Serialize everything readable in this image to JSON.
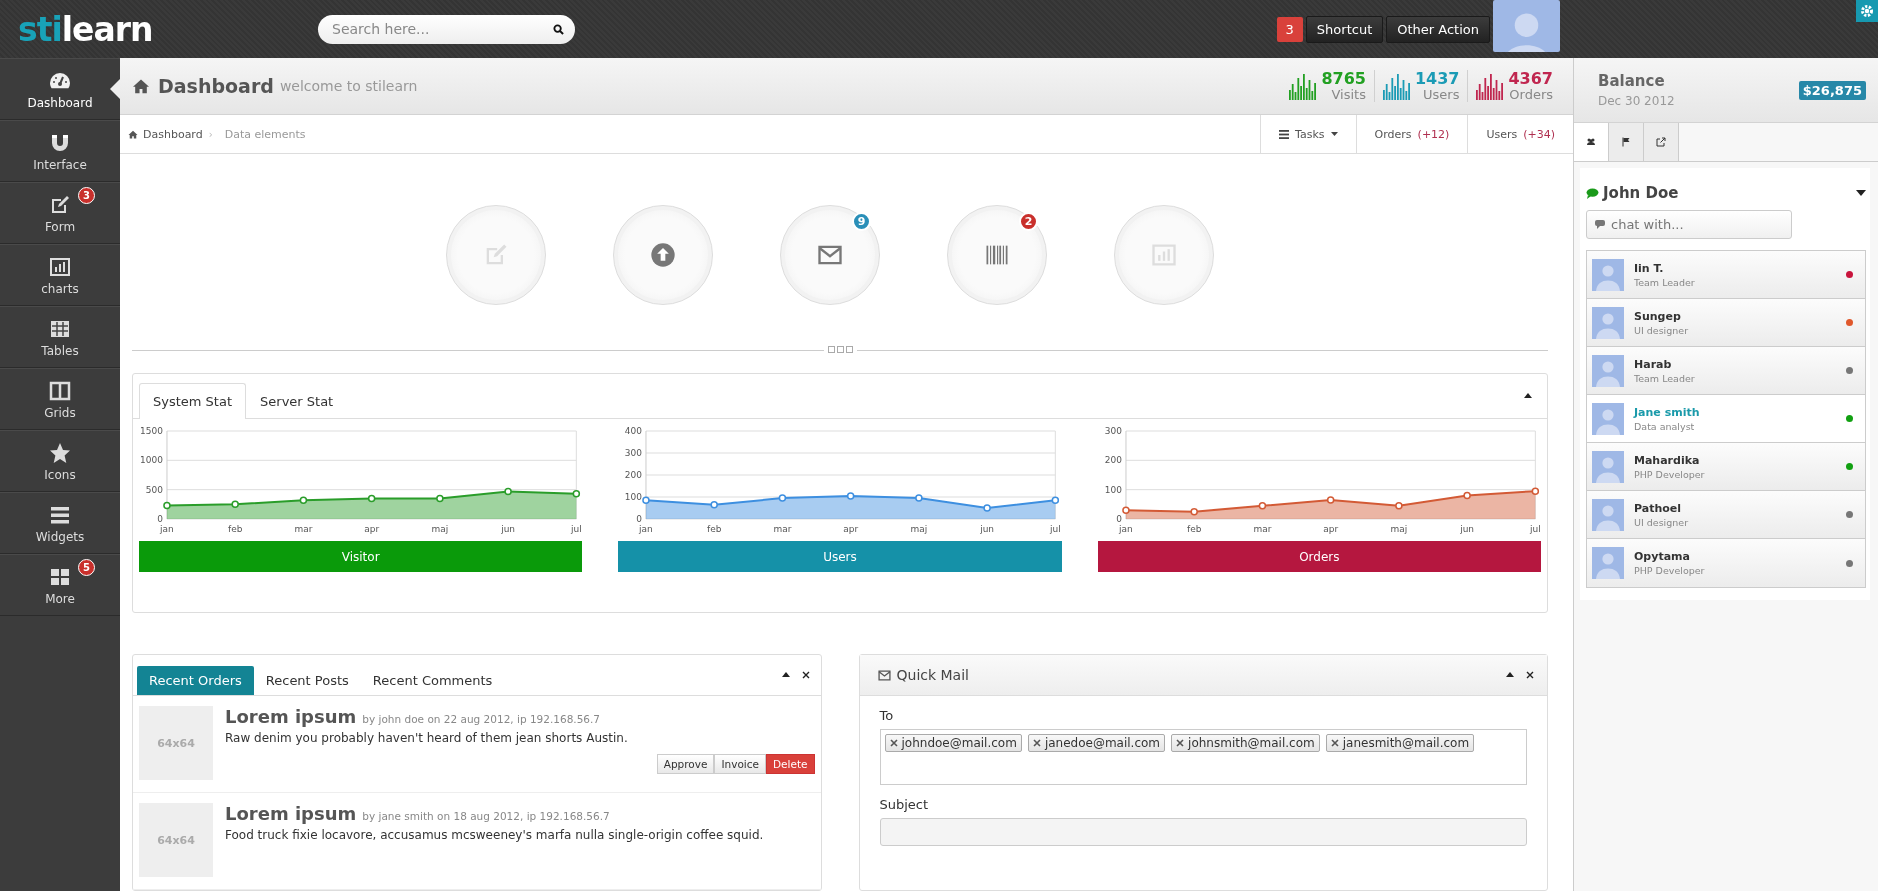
{
  "topbar": {
    "logo": {
      "accent": "sti",
      "rest": "learn"
    },
    "search": {
      "placeholder": "Search here..."
    },
    "notification_count": "3",
    "buttons": [
      "Shortcut",
      "Other Action"
    ]
  },
  "sidebar": {
    "items": [
      {
        "label": "Dashboard",
        "selected": true
      },
      {
        "label": "Interface",
        "selected": false
      },
      {
        "label": "Form",
        "badge": "3",
        "selected": false
      },
      {
        "label": "charts",
        "selected": false
      },
      {
        "label": "Tables",
        "selected": false
      },
      {
        "label": "Grids",
        "selected": false
      },
      {
        "label": "Icons",
        "selected": false
      },
      {
        "label": "Widgets",
        "selected": false
      },
      {
        "label": "More",
        "badge": "5",
        "selected": false
      }
    ]
  },
  "header": {
    "title": "Dashboard",
    "subtitle": "welcome to stilearn",
    "stats": [
      {
        "value": "8765",
        "label": "Visits",
        "color": "#22a022"
      },
      {
        "value": "1437",
        "label": "Users",
        "color": "#1b9bb5"
      },
      {
        "value": "4367",
        "label": "Orders",
        "color": "#c0264f"
      }
    ]
  },
  "breadcrumb": {
    "items": [
      "Dashboard",
      "Data elements"
    ],
    "separator": "›"
  },
  "header_tabs": [
    {
      "kind": "dropdown",
      "label": "Tasks"
    },
    {
      "kind": "counter",
      "label": "Orders",
      "count": "(+12)"
    },
    {
      "kind": "counter",
      "label": "Users",
      "count": "(+34)"
    }
  ],
  "shortcuts": [
    {
      "kind": "edit"
    },
    {
      "kind": "upload"
    },
    {
      "kind": "mail",
      "badge": "9",
      "color": "#2a8fb8"
    },
    {
      "kind": "barcode",
      "badge": "2",
      "color": "#c9302c"
    },
    {
      "kind": "chart"
    }
  ],
  "stats_panel": {
    "tabs": [
      {
        "label": "System Stat",
        "selected": true
      },
      {
        "label": "Server Stat",
        "selected": false
      }
    ],
    "charts": [
      {
        "color": "#0a9a0a",
        "chart_data": {
          "type": "area",
          "grid": true,
          "categories": [
            "jan",
            "feb",
            "mar",
            "apr",
            "maj",
            "jun",
            "jul"
          ],
          "series": [
            {
              "name": "Visitor",
              "color": "#2a9d2a",
              "values": [
                230,
                250,
                320,
                350,
                350,
                470,
                430
              ]
            }
          ],
          "ylim": [
            0,
            1500
          ],
          "yticks": [
            0,
            500,
            1000,
            1500
          ]
        }
      },
      {
        "color": "#1591a8",
        "chart_data": {
          "type": "area",
          "grid": true,
          "categories": [
            "jan",
            "feb",
            "mar",
            "apr",
            "maj",
            "jun",
            "jul"
          ],
          "series": [
            {
              "name": "Users",
              "color": "#3d8fe0",
              "values": [
                85,
                65,
                95,
                105,
                95,
                50,
                85
              ]
            }
          ],
          "ylim": [
            0,
            400
          ],
          "yticks": [
            0,
            100,
            200,
            300,
            400
          ]
        }
      },
      {
        "color": "#b5173f",
        "chart_data": {
          "type": "area",
          "grid": true,
          "categories": [
            "jan",
            "feb",
            "mar",
            "apr",
            "maj",
            "jun",
            "jul"
          ],
          "series": [
            {
              "name": "Orders",
              "color": "#d35a35",
              "values": [
                30,
                25,
                45,
                65,
                45,
                80,
                95
              ]
            }
          ],
          "ylim": [
            0,
            300
          ],
          "yticks": [
            0,
            100,
            200,
            300
          ]
        }
      }
    ]
  },
  "recent": {
    "tabs": [
      {
        "label": "Recent Orders",
        "selected": true
      },
      {
        "label": "Recent Posts",
        "selected": false
      },
      {
        "label": "Recent Comments",
        "selected": false
      }
    ],
    "items": [
      {
        "thumbnail": "64x64",
        "title": "Lorem ipsum",
        "meta": "by john doe on 22 aug 2012, ip 192.168.56.7",
        "text": "Raw denim you probably haven't heard of them jean shorts Austin.",
        "buttons": [
          {
            "label": "Approve",
            "kind": "default"
          },
          {
            "label": "Invoice",
            "kind": "default"
          },
          {
            "label": "Delete",
            "kind": "danger"
          }
        ]
      },
      {
        "thumbnail": "64x64",
        "title": "Lorem ipsum",
        "meta": "by jane smith on 18 aug 2012, ip 192.168.56.7",
        "text": "Food truck fixie locavore, accusamus mcsweeney's marfa nulla single-origin coffee squid."
      }
    ]
  },
  "quick_mail": {
    "title": "Quick Mail",
    "fields": [
      {
        "label": "To",
        "kind": "tags",
        "tags": [
          "johndoe@mail.com",
          "janedoe@mail.com",
          "johnsmith@mail.com",
          "janesmith@mail.com"
        ]
      },
      {
        "label": "Subject",
        "kind": "text"
      }
    ]
  },
  "right_panel": {
    "balance": {
      "title": "Balance",
      "date": "Dec 30 2012",
      "amount": "$26,875"
    },
    "tabs": [
      {
        "selected": true
      },
      {
        "selected": false
      },
      {
        "selected": false
      }
    ],
    "chat": {
      "user": "John Doe",
      "placeholder": "chat with..."
    },
    "contacts": [
      {
        "name": "Iin T.",
        "role": "Team Leader",
        "color": "#c8143c",
        "selected": false
      },
      {
        "name": "Sungep",
        "role": "UI designer",
        "color": "#e0582b",
        "selected": false
      },
      {
        "name": "Harab",
        "role": "Team Leader",
        "color": "#777777",
        "selected": false
      },
      {
        "name": "Jane smith",
        "role": "Data analyst",
        "color": "#11a011",
        "selected": true
      },
      {
        "name": "Mahardika",
        "role": "PHP Developer",
        "color": "#11a011",
        "selected": false
      },
      {
        "name": "Pathoel",
        "role": "UI designer",
        "color": "#777777",
        "selected": false
      },
      {
        "name": "Opytama",
        "role": "PHP Developer",
        "color": "#777777",
        "selected": false
      }
    ]
  }
}
